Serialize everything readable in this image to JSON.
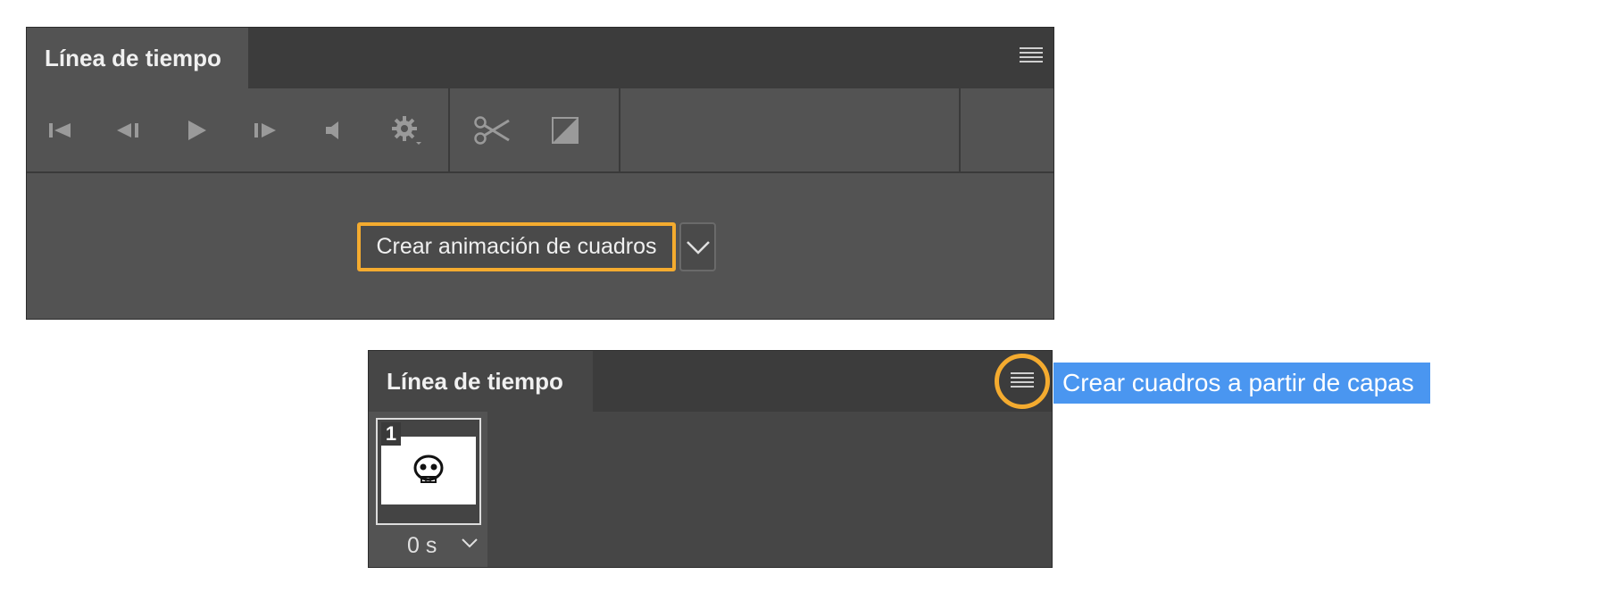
{
  "panel_top": {
    "tab_title": "Línea de tiempo",
    "toolbar": {
      "icons": [
        "first-frame-icon",
        "previous-frame-icon",
        "play-icon",
        "next-frame-icon",
        "audio-icon",
        "gear-icon",
        "scissors-icon",
        "transition-icon"
      ]
    },
    "create_button_label": "Crear animación de cuadros"
  },
  "panel_bottom": {
    "tab_title": "Línea de tiempo",
    "frame": {
      "number": "1",
      "delay": "0 s"
    },
    "callout_text": "Crear cuadros a partir de capas"
  },
  "colors": {
    "highlight": "#f4ab2f",
    "callout": "#4a96f0",
    "panel": "#535353"
  }
}
